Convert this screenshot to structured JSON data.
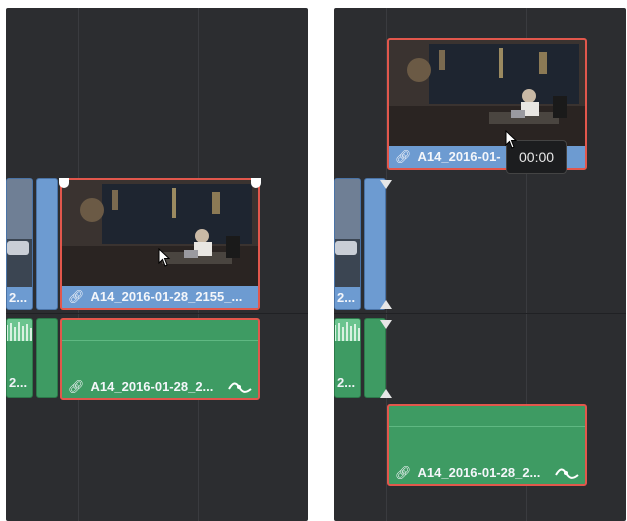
{
  "left_panel": {
    "video_clip_label": "A14_2016-01-28_2155_...",
    "audio_clip_label": "A14_2016-01-28_2...",
    "partial_video_label": "2...",
    "partial_audio_label": "2..."
  },
  "right_panel": {
    "dragged_video_label": "A14_2016-01-",
    "audio_clip_label": "A14_2016-01-28_2...",
    "partial_video_label": "2...",
    "partial_audio_label": "2...",
    "tooltip_timecode": "00:00"
  },
  "icons": {
    "link": "link-icon",
    "keyframe_curve": "curve-icon",
    "cursor": "mouse-pointer-icon",
    "edit_point": "edit-point-triangle-icon"
  },
  "colors": {
    "video_clip": "#6d9bd1",
    "audio_clip": "#3e9b63",
    "selection": "#e2574c",
    "timeline_bg": "#2c2d30"
  }
}
